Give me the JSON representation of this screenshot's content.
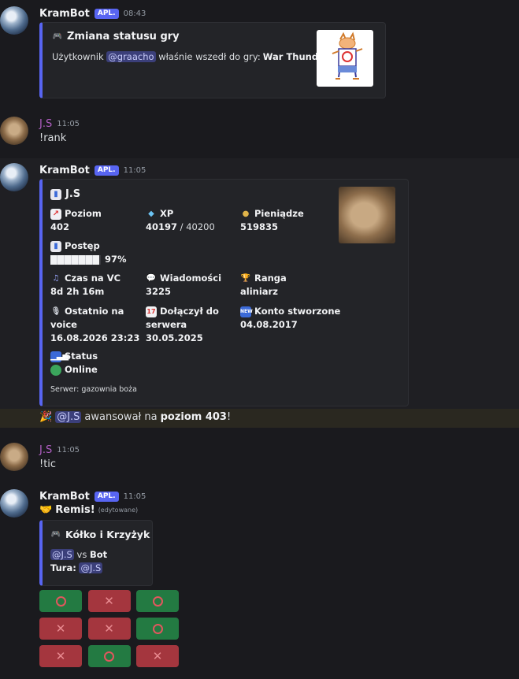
{
  "messages": {
    "m1": {
      "author": "KramBot",
      "tag": "APL.",
      "time": "08:43",
      "embed": {
        "title": "Zmiana statusu gry",
        "text_prefix": "Użytkownik",
        "mention": "@graacho",
        "text_mid": "właśnie wszedł do gry:",
        "game": "War Thunder",
        "text_suffix": "!"
      }
    },
    "m2": {
      "author": "J.S",
      "time": "11:05",
      "text": "!rank"
    },
    "m3": {
      "author": "KramBot",
      "tag": "APL.",
      "time": "11:05",
      "embed": {
        "title": "J.S",
        "fields": {
          "level": {
            "name": "Poziom",
            "value": "402"
          },
          "xp": {
            "name": "XP",
            "value": "40197",
            "value_max": "/ 40200"
          },
          "money": {
            "name": "Pieniądze",
            "value": "519835"
          },
          "progress": {
            "name": "Postęp",
            "value": "97%",
            "fraction": 0.97
          },
          "vc": {
            "name": "Czas na VC",
            "value": "8d 2h 16m"
          },
          "messages": {
            "name": "Wiadomości",
            "value": "3225"
          },
          "rank": {
            "name": "Ranga",
            "value": "aliniarz"
          },
          "last_voice": {
            "name_line1": "Ostatnio na",
            "name_line2": "voice",
            "value": "16.08.2026 23:23"
          },
          "joined": {
            "name_line1": "Dołączył do",
            "name_line2": "serwera",
            "value": "30.05.2025"
          },
          "created": {
            "name": "Konto stworzone",
            "value": "04.08.2017"
          },
          "status": {
            "name": "Status",
            "value": "Online"
          }
        },
        "footer": "Serwer: gazownia boża"
      }
    },
    "levelup": {
      "mention": "@J.S",
      "text_mid": "awansował na",
      "level": "poziom 403",
      "suffix": "!"
    },
    "m4": {
      "author": "J.S",
      "time": "11:05",
      "text": "!tic"
    },
    "m5": {
      "author": "KramBot",
      "tag": "APL.",
      "time": "11:05",
      "result": "Remis!",
      "edited": "(edytowane)",
      "embed": {
        "title": "Kółko i Krzyżyk",
        "player1": "@J.S",
        "vs": "vs",
        "player2": "Bot",
        "turn_label": "Tura:",
        "turn_mention": "@J.S"
      },
      "board": [
        [
          "O",
          "X",
          "O"
        ],
        [
          "X",
          "X",
          "O"
        ],
        [
          "X",
          "O",
          "X"
        ]
      ],
      "board_colors": [
        [
          "green",
          "red",
          "green"
        ],
        [
          "red",
          "red",
          "green"
        ],
        [
          "red",
          "green",
          "red"
        ]
      ]
    }
  },
  "colors": {
    "accent": "#5865f2",
    "user_name": "#b25fc4",
    "green_btn": "#237a42",
    "red_btn": "#a4363e",
    "online": "#3ba55c"
  }
}
